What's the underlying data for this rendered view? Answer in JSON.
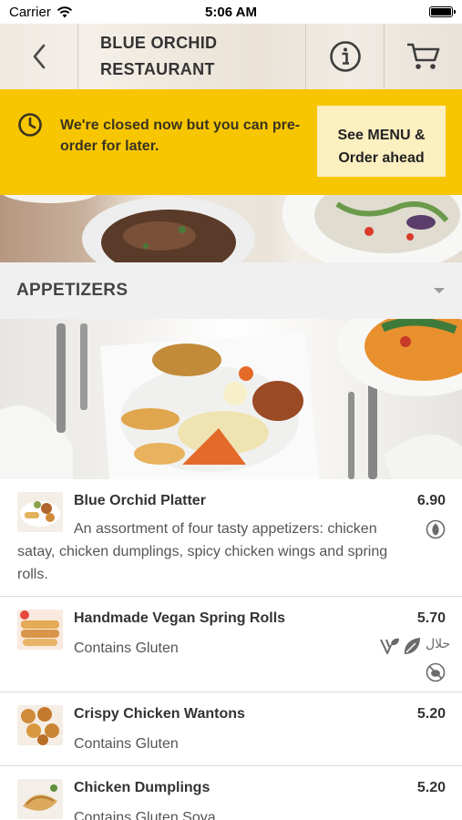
{
  "status_bar": {
    "carrier": "Carrier",
    "time": "5:06 AM"
  },
  "header": {
    "title_line1": "BLUE ORCHID",
    "title_line2": "RESTAURANT"
  },
  "banner": {
    "message": "We're closed now but you can pre-order for later.",
    "button_line1": "See MENU &",
    "button_line2": "Order ahead"
  },
  "section": {
    "title": "APPETIZERS"
  },
  "menu_items": [
    {
      "name": "Blue Orchid Platter",
      "price": "6.90",
      "description": "An assortment of four tasty appetizers: chicken satay, chicken dumplings, spicy chicken wings and spring rolls."
    },
    {
      "name": "Handmade Vegan Spring Rolls",
      "price": "5.70",
      "description": "Contains Gluten",
      "halal_text": "حلال"
    },
    {
      "name": "Crispy Chicken Wantons",
      "price": "5.20",
      "description": "Contains Gluten"
    },
    {
      "name": "Chicken Dumplings",
      "price": "5.20",
      "description": "Contains Gluten,Soya"
    }
  ],
  "colors": {
    "banner": "#f7c600",
    "banner_button": "#fcefc0",
    "section_bg": "#f0f0f0",
    "text_dark": "#333333"
  }
}
